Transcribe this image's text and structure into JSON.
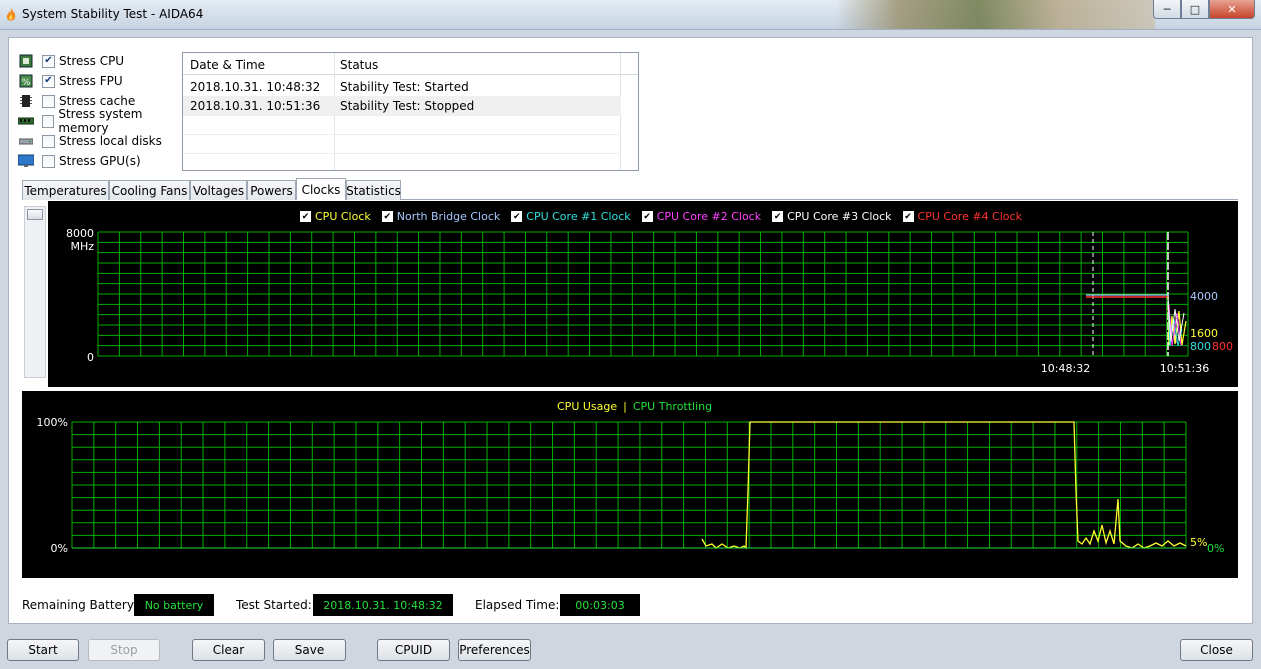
{
  "window": {
    "title": "System Stability Test - AIDA64"
  },
  "stress_options": [
    {
      "label": "Stress CPU",
      "checked": true,
      "icon": "cpu-chip-icon"
    },
    {
      "label": "Stress FPU",
      "checked": true,
      "icon": "fpu-percent-icon"
    },
    {
      "label": "Stress cache",
      "checked": false,
      "icon": "cache-chip-icon"
    },
    {
      "label": "Stress system memory",
      "checked": false,
      "icon": "memory-module-icon"
    },
    {
      "label": "Stress local disks",
      "checked": false,
      "icon": "disk-drive-icon"
    },
    {
      "label": "Stress GPU(s)",
      "checked": false,
      "icon": "monitor-icon"
    }
  ],
  "log": {
    "columns": [
      "Date & Time",
      "Status"
    ],
    "rows": [
      [
        "2018.10.31. 10:48:32",
        "Stability Test: Started"
      ],
      [
        "2018.10.31. 10:51:36",
        "Stability Test: Stopped"
      ]
    ]
  },
  "tabs": [
    "Temperatures",
    "Cooling Fans",
    "Voltages",
    "Powers",
    "Clocks",
    "Statistics"
  ],
  "active_tab": "Clocks",
  "clock_chart": {
    "legend": [
      {
        "label": "CPU Clock",
        "color": "#ffff33"
      },
      {
        "label": "North Bridge Clock",
        "color": "#a8c8ff"
      },
      {
        "label": "CPU Core #1 Clock",
        "color": "#30e0e0"
      },
      {
        "label": "CPU Core #2 Clock",
        "color": "#ff40ff"
      },
      {
        "label": "CPU Core #3 Clock",
        "color": "#ffffff"
      },
      {
        "label": "CPU Core #4 Clock",
        "color": "#ff3030"
      }
    ],
    "y_max_label": "8000",
    "y_unit": "MHz",
    "y_min_label": "0",
    "time_labels": [
      "10:48:32",
      "10:51:36"
    ],
    "value_labels": [
      {
        "text": "4000",
        "color": "#a8c8ff"
      },
      {
        "text": "1600",
        "color": "#ffff33"
      },
      {
        "text": "800",
        "color": "#30e0e0"
      },
      {
        "text": "800",
        "color": "#ff3030"
      }
    ],
    "grid_color": "#00b000"
  },
  "usage_chart": {
    "legend": [
      {
        "label": "CPU Usage",
        "color": "#ffff33"
      },
      {
        "label": "CPU Throttling",
        "color": "#22e03b"
      }
    ],
    "legend_sep": "|",
    "y_max_label": "100%",
    "y_min_label": "0%",
    "value_labels": [
      {
        "text": "5%",
        "color": "#ffff33"
      },
      {
        "text": "0%",
        "color": "#22e03b"
      }
    ]
  },
  "status": {
    "battery_label": "Remaining Battery:",
    "battery_value": "No battery",
    "started_label": "Test Started:",
    "started_value": "2018.10.31. 10:48:32",
    "elapsed_label": "Elapsed Time:",
    "elapsed_value": "00:03:03"
  },
  "buttons": {
    "start": "Start",
    "stop": "Stop",
    "clear": "Clear",
    "save": "Save",
    "cpuid": "CPUID",
    "preferences": "Preferences",
    "close": "Close"
  }
}
